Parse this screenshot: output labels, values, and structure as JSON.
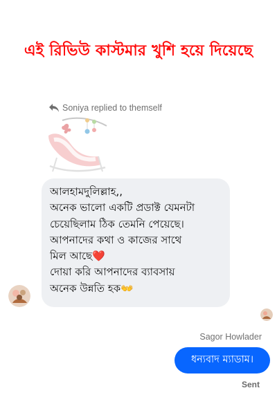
{
  "headline": "এই রিভিউ কাস্টমার খুশি হয়ে দিয়েছে",
  "reply_note": {
    "text": "Soniya replied to themself",
    "icon": "reply-arrow-icon"
  },
  "quoted_image": {
    "description_icon": "baby-bouncer-photo"
  },
  "incoming_message": {
    "lines": [
      "আলহামদুলিল্লাহ,,",
      "অনেক ভালো একটি প্রডাক্ট যেমনটা",
      "চেয়েছিলাম ঠিক তেমনি পেয়েছে।",
      "আপনাদের কথা ও কাজের সাথে",
      "মিল আছে❤️",
      "দোয়া করি আপনাদের ব্যাবসায়",
      "অনেক উন্নতি হক👐"
    ]
  },
  "outgoing_message": {
    "sender_name": "Sagor Howlader",
    "text": "ধন্যবাদ ম্যাডাম।",
    "status": "Sent"
  },
  "colors": {
    "headline": "#ff0a0a",
    "incoming_bubble": "#eef0f3",
    "outgoing_bubble": "#0866ff",
    "meta_text": "#707070"
  }
}
